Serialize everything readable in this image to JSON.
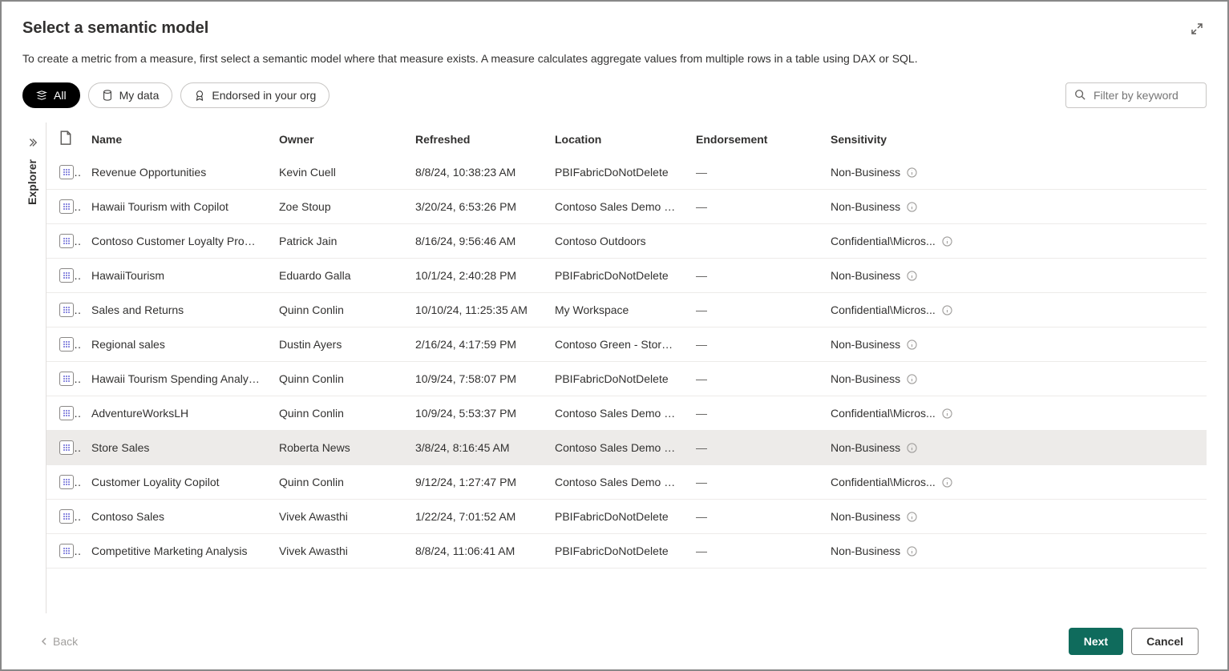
{
  "header": {
    "title": "Select a semantic model",
    "description": "To create a metric from a measure, first select a semantic model where that measure exists. A measure calculates aggregate values from multiple rows in a table using DAX or SQL."
  },
  "filters": {
    "all": "All",
    "my_data": "My data",
    "endorsed": "Endorsed in your org"
  },
  "search": {
    "placeholder": "Filter by keyword"
  },
  "explorer": {
    "label": "Explorer"
  },
  "table": {
    "headers": {
      "name": "Name",
      "owner": "Owner",
      "refreshed": "Refreshed",
      "location": "Location",
      "endorsement": "Endorsement",
      "sensitivity": "Sensitivity"
    },
    "rows": [
      {
        "name": "Revenue Opportunities",
        "owner": "Kevin Cuell",
        "refreshed": "8/8/24, 10:38:23 AM",
        "location": "PBIFabricDoNotDelete",
        "endorsement": "—",
        "sensitivity": "Non-Business",
        "selected": false
      },
      {
        "name": "Hawaii Tourism with Copilot",
        "owner": "Zoe Stoup",
        "refreshed": "3/20/24, 6:53:26 PM",
        "location": "Contoso Sales Demo Sp...",
        "endorsement": "—",
        "sensitivity": "Non-Business",
        "selected": false
      },
      {
        "name": "Contoso Customer Loyalty Progr...",
        "owner": "Patrick Jain",
        "refreshed": "8/16/24, 9:56:46 AM",
        "location": "Contoso Outdoors",
        "endorsement": "",
        "sensitivity": "Confidential\\Micros...",
        "selected": false
      },
      {
        "name": "HawaiiTourism",
        "owner": "Eduardo Galla",
        "refreshed": "10/1/24, 2:40:28 PM",
        "location": "PBIFabricDoNotDelete",
        "endorsement": "—",
        "sensitivity": "Non-Business",
        "selected": false
      },
      {
        "name": "Sales and Returns",
        "owner": "Quinn Conlin",
        "refreshed": "10/10/24, 11:25:35 AM",
        "location": "My Workspace",
        "endorsement": "—",
        "sensitivity": "Confidential\\Micros...",
        "selected": false
      },
      {
        "name": "Regional sales",
        "owner": "Dustin Ayers",
        "refreshed": "2/16/24, 4:17:59 PM",
        "location": "Contoso Green - Stores ...",
        "endorsement": "—",
        "sensitivity": "Non-Business",
        "selected": false
      },
      {
        "name": "Hawaii Tourism Spending Analysis",
        "owner": "Quinn Conlin",
        "refreshed": "10/9/24, 7:58:07 PM",
        "location": "PBIFabricDoNotDelete",
        "endorsement": "—",
        "sensitivity": "Non-Business",
        "selected": false
      },
      {
        "name": "AdventureWorksLH",
        "owner": "Quinn Conlin",
        "refreshed": "10/9/24, 5:53:37 PM",
        "location": "Contoso Sales Demo Sp...",
        "endorsement": "—",
        "sensitivity": "Confidential\\Micros...",
        "selected": false
      },
      {
        "name": "Store Sales",
        "owner": "Roberta News",
        "refreshed": "3/8/24, 8:16:45 AM",
        "location": "Contoso Sales Demo Sp...",
        "endorsement": "—",
        "sensitivity": "Non-Business",
        "selected": true
      },
      {
        "name": "Customer Loyality Copilot",
        "owner": "Quinn Conlin",
        "refreshed": "9/12/24, 1:27:47 PM",
        "location": "Contoso Sales Demo Sp...",
        "endorsement": "—",
        "sensitivity": "Confidential\\Micros...",
        "selected": false
      },
      {
        "name": "Contoso Sales",
        "owner": "Vivek Awasthi",
        "refreshed": "1/22/24, 7:01:52 AM",
        "location": "PBIFabricDoNotDelete",
        "endorsement": "—",
        "sensitivity": "Non-Business",
        "selected": false
      },
      {
        "name": "Competitive Marketing Analysis",
        "owner": "Vivek Awasthi",
        "refreshed": "8/8/24, 11:06:41 AM",
        "location": "PBIFabricDoNotDelete",
        "endorsement": "—",
        "sensitivity": "Non-Business",
        "selected": false
      }
    ]
  },
  "footer": {
    "back": "Back",
    "next": "Next",
    "cancel": "Cancel"
  }
}
